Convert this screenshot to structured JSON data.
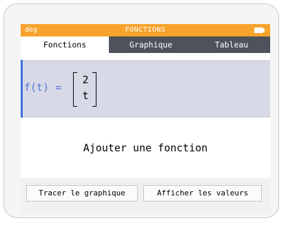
{
  "status": {
    "angle_unit": "deg",
    "app_title": "FONCTIONS"
  },
  "tabs": [
    {
      "label": "Fonctions",
      "active": true
    },
    {
      "label": "Graphique",
      "active": false
    },
    {
      "label": "Tableau",
      "active": false
    }
  ],
  "function": {
    "label": "f(t) =",
    "matrix": [
      "2",
      "t"
    ]
  },
  "add_function_label": "Ajouter une fonction",
  "buttons": {
    "plot": "Tracer le graphique",
    "values": "Afficher les valeurs"
  },
  "colors": {
    "status_bar": "#f7a32c",
    "tab_bar": "#4d525b",
    "function_highlight": "#d8d9e6",
    "function_name": "#5575d8"
  }
}
